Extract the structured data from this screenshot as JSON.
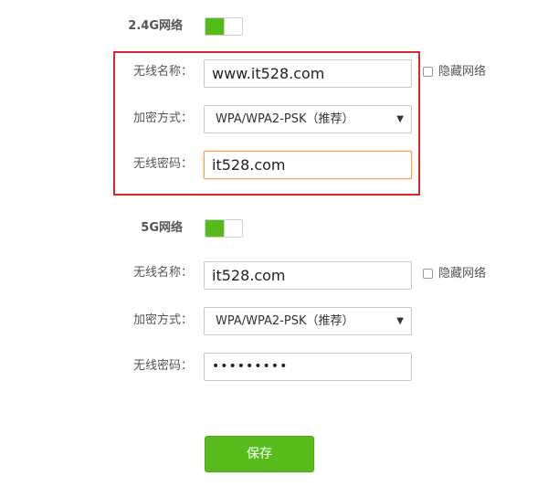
{
  "colors": {
    "toggle_on": "#55bb18",
    "highlight_border": "#d9282f",
    "save_button": "#58bc1d",
    "focused_border": "#f0a050"
  },
  "band_24g": {
    "title": "2.4G网络",
    "enabled": true,
    "ssid_label": "无线名称：",
    "ssid_value": "www.it528.com",
    "hide_label": "隐藏网络",
    "hide_checked": false,
    "encryption_label": "加密方式：",
    "encryption_value": "WPA/WPA2-PSK（推荐）",
    "password_label": "无线密码：",
    "password_value": "it528.com"
  },
  "band_5g": {
    "title": "5G网络",
    "enabled": true,
    "ssid_label": "无线名称：",
    "ssid_value": "it528.com",
    "hide_label": "隐藏网络",
    "hide_checked": false,
    "encryption_label": "加密方式：",
    "encryption_value": "WPA/WPA2-PSK（推荐）",
    "password_label": "无线密码：",
    "password_value": "•••••••••"
  },
  "save_label": "保存",
  "icons": {
    "dropdown_arrow": "▼"
  }
}
